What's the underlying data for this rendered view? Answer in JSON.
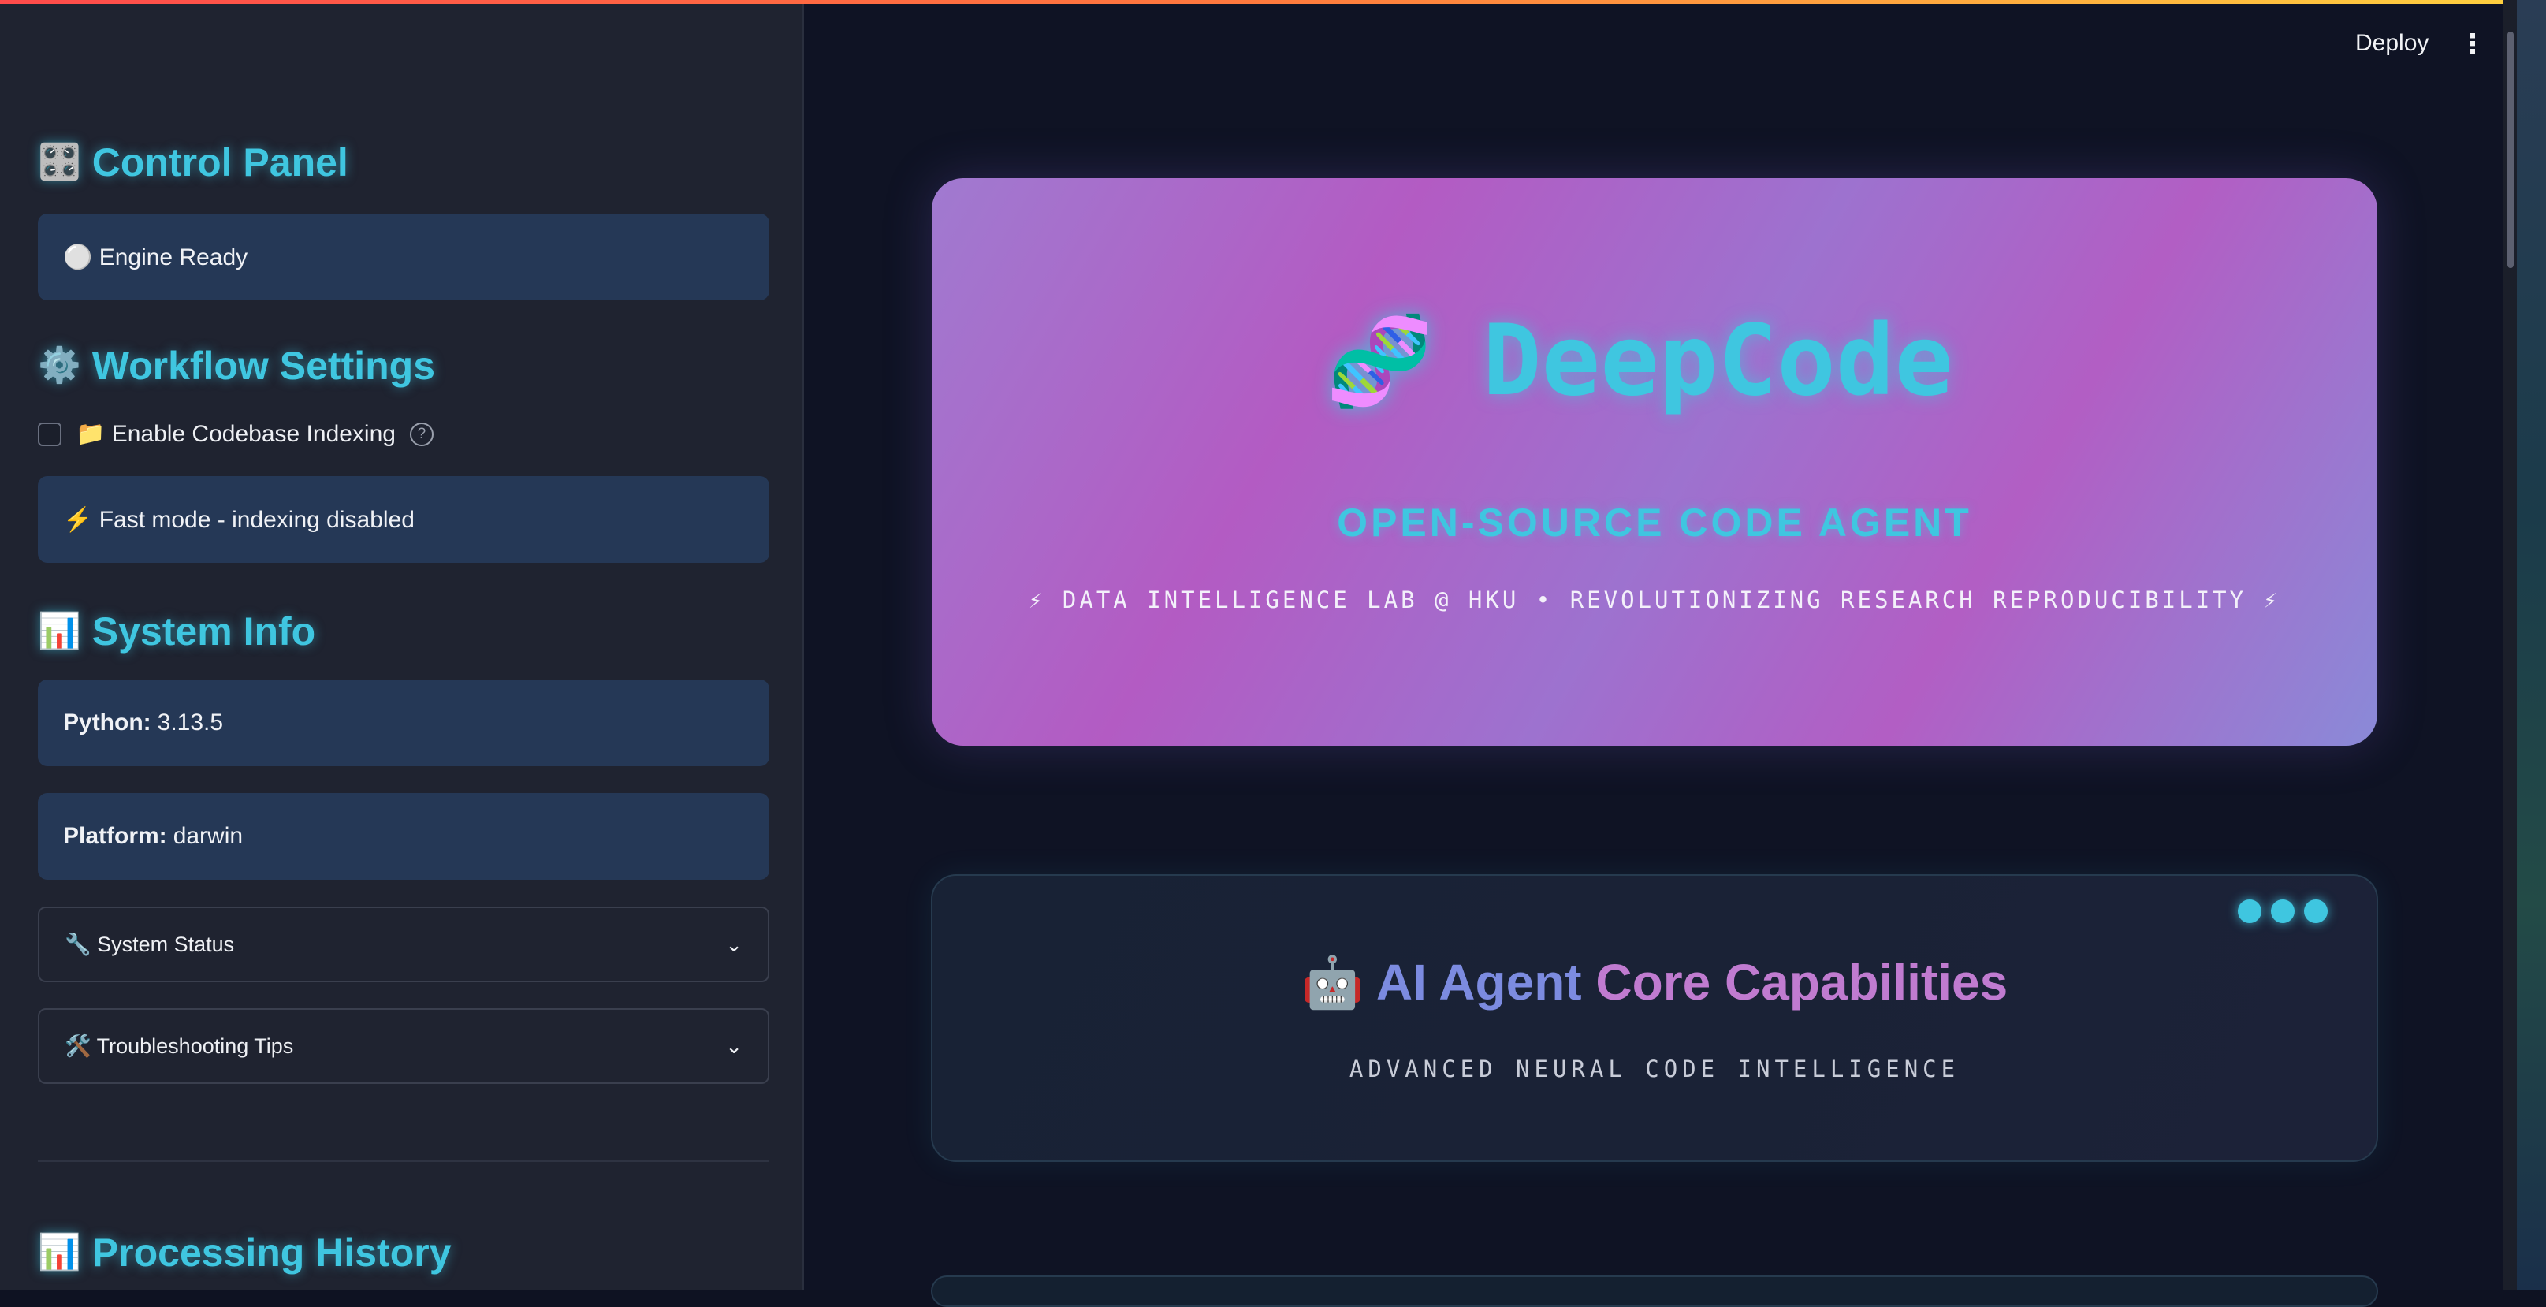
{
  "sidebar": {
    "control_panel": {
      "icon": "🎛️",
      "title": "Control Panel",
      "status": "⚪ Engine Ready"
    },
    "workflow_settings": {
      "icon": "⚙️",
      "title": "Workflow Settings",
      "checkbox_label": "📁 Enable Codebase Indexing",
      "checkbox_checked": false,
      "help_glyph": "?",
      "mode_status": "⚡ Fast mode - indexing disabled"
    },
    "system_info": {
      "icon": "📊",
      "title": "System Info",
      "python_label": "Python:",
      "python_value": "3.13.5",
      "platform_label": "Platform:",
      "platform_value": "darwin"
    },
    "expanders": [
      {
        "label": "🔧 System Status",
        "chevron": "⌄"
      },
      {
        "label": "🛠️ Troubleshooting Tips",
        "chevron": "⌄"
      }
    ],
    "processing_history": {
      "icon": "📊",
      "title": "Processing History"
    }
  },
  "header": {
    "deploy_label": "Deploy",
    "menu_glyph": "⋮"
  },
  "hero": {
    "icon": "🧬",
    "title": "DeepCode",
    "subtitle": "OPEN-SOURCE CODE AGENT",
    "tagline": "⚡ DATA INTELLIGENCE LAB @ HKU • REVOLUTIONIZING RESEARCH REPRODUCIBILITY ⚡"
  },
  "capabilities": {
    "icon": "🤖",
    "title_part1": "AI Agent",
    "title_part2": "Core Capabilities",
    "subtitle": "ADVANCED NEURAL CODE INTELLIGENCE"
  },
  "colors": {
    "accent": "#3fc6e0",
    "sidebar_bg": "#1f2330",
    "main_bg": "#0f1324",
    "info_box": "#253856"
  }
}
